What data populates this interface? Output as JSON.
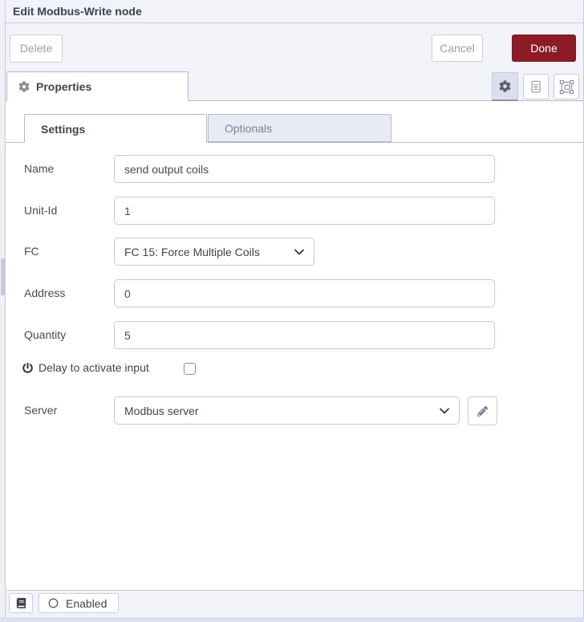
{
  "window": {
    "title": "Edit Modbus-Write node"
  },
  "header_buttons": {
    "delete": "Delete",
    "cancel": "Cancel",
    "done": "Done"
  },
  "tray": {
    "properties_tab": "Properties",
    "icon_buttons": [
      "gear",
      "document",
      "appearance"
    ],
    "selected_icon_button": "gear"
  },
  "tabs": [
    {
      "label": "Settings",
      "active": true
    },
    {
      "label": "Optionals",
      "active": false
    }
  ],
  "form": {
    "name": {
      "label": "Name",
      "value": "send output coils"
    },
    "unit_id": {
      "label": "Unit-Id",
      "value": "1"
    },
    "fc": {
      "label": "FC",
      "selected": "FC 15: Force Multiple Coils"
    },
    "address": {
      "label": "Address",
      "value": "0"
    },
    "quantity": {
      "label": "Quantity",
      "value": "5"
    },
    "delay_to_activate": {
      "label": "Delay to activate input",
      "checked": false
    },
    "server": {
      "label": "Server",
      "selected": "Modbus server"
    }
  },
  "footer": {
    "enabled": "Enabled"
  },
  "icons": {
    "properties_tab": "gear-icon",
    "tray_buttons": [
      "gear-icon",
      "document-icon",
      "appearance-frame-icon"
    ],
    "delay_row": "power-icon",
    "server_edit": "pencil-icon",
    "footer_left": "book-icon",
    "enabled": "circle-outline-icon",
    "selects": "chevron-down-icon"
  },
  "colors": {
    "done_button": "#8c1b26",
    "selected_icon_bg": "#dcdfef",
    "inactive_tab_bg": "#e8eaf4",
    "chrome_bg": "#f2f3f8"
  }
}
